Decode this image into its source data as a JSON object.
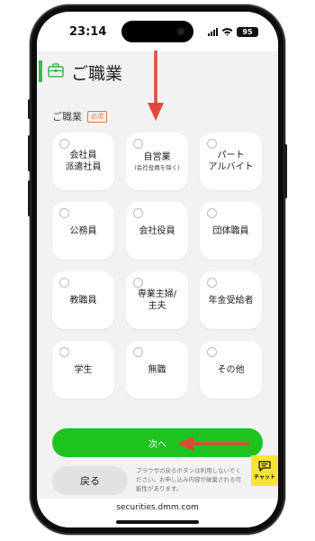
{
  "status_bar": {
    "time": "23:14",
    "battery": "95"
  },
  "header": {
    "title": "ご職業"
  },
  "section": {
    "label": "ご職業",
    "required_badge": "必須"
  },
  "options": [
    {
      "line1": "会社員",
      "line2": "派遣社員",
      "small": ""
    },
    {
      "line1": "自営業",
      "line2": "",
      "small": "(会社役員を除く)"
    },
    {
      "line1": "パート",
      "line2": "アルバイト",
      "small": ""
    },
    {
      "line1": "公務員",
      "line2": "",
      "small": ""
    },
    {
      "line1": "会社役員",
      "line2": "",
      "small": ""
    },
    {
      "line1": "団体職員",
      "line2": "",
      "small": ""
    },
    {
      "line1": "教職員",
      "line2": "",
      "small": ""
    },
    {
      "line1": "専業主婦/",
      "line2": "主夫",
      "small": ""
    },
    {
      "line1": "年金受給者",
      "line2": "",
      "small": ""
    },
    {
      "line1": "学生",
      "line2": "",
      "small": ""
    },
    {
      "line1": "無職",
      "line2": "",
      "small": ""
    },
    {
      "line1": "その他",
      "line2": "",
      "small": ""
    }
  ],
  "buttons": {
    "next": "次へ",
    "back": "戻る"
  },
  "note": "ブラウザの戻るボタンは利用しないでください。お申し込み内容が破棄される可能性があります。",
  "chat": {
    "label": "チャット"
  },
  "browser": {
    "url": "securities.dmm.com"
  },
  "colors": {
    "accent_green": "#1fc31f",
    "required_orange": "#e8763b",
    "annotation_red": "#e04a3c",
    "chat_yellow": "#f6e633"
  }
}
